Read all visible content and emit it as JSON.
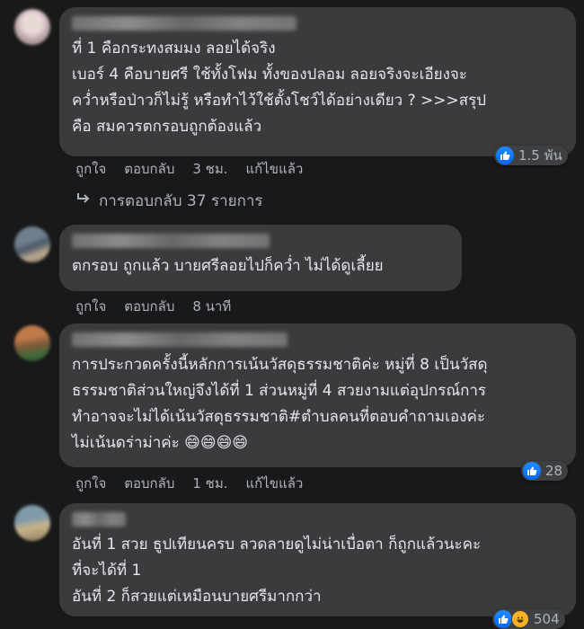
{
  "comments": [
    {
      "text": "ที่ 1 คือกระทงสมมง ลอยได้จริง\nเบอร์ 4 คือบายศรี ใช้ทั้งโฟม ทั้งของปลอม ลอยจริงจะเอียงจะ\nคว่ำหรือป่าวก็ไม่รู้ หรือทำไว้ใช้ตั้งโชว์ได้อย่างเดียว ? >>>สรุป\nคือ สมควรตกรอบถูกต้องแล้ว",
      "actions": {
        "like": "ถูกใจ",
        "reply": "ตอบกลับ",
        "time": "3 ชม.",
        "edited": "แก้ไขแล้ว"
      },
      "reaction_count": "1.5 พัน",
      "replies_label": "การตอบกลับ 37 รายการ"
    },
    {
      "text": "ตกรอบ ถูกแล้ว บายศรีลอยไปก็คว่ำ ไม่ได้ดูเลี้ยย",
      "actions": {
        "like": "ถูกใจ",
        "reply": "ตอบกลับ",
        "time": "8 นาที"
      }
    },
    {
      "text": "การประกวดครั้งนี้หลักการเน้นวัสดุธรรมชาติค่ะ หมู่ที่ 8 เป็นวัสดุ\nธรรมชาติส่วนใหญ่จึงได้ที่ 1 ส่วนหมู่ที่ 4 สวยงามแต่อุปกรณ์การ\nทำอาจจะไม่ได้เน้นวัสดุธรรมชาติ#ตำบลคนที่ตอบคำถามเองค่ะ\nไม่เน้นดร่าม่าค่ะ 😄😄😄😄",
      "actions": {
        "like": "ถูกใจ",
        "reply": "ตอบกลับ",
        "time": "1 ชม.",
        "edited": "แก้ไขแล้ว"
      },
      "reaction_count": "28"
    },
    {
      "text": "อันที่ 1 สวย ธูปเทียนครบ ลวดลายดูไม่น่าเบื่อตา ก็ถูกแล้วนะคะ\nที่จะได้ที่ 1\nอันที่ 2 ก็สวยแต่เหมือนบายศรีมากกว่า",
      "reaction_count": "504"
    }
  ],
  "colors": {
    "background": "#18191a",
    "bubble": "#3a3b3c",
    "text": "#e4e6eb",
    "secondary_text": "#b0b3b8",
    "like_blue": "#0866ff"
  },
  "icons": [
    "like-icon",
    "haha-icon",
    "reply-arrow-icon"
  ]
}
